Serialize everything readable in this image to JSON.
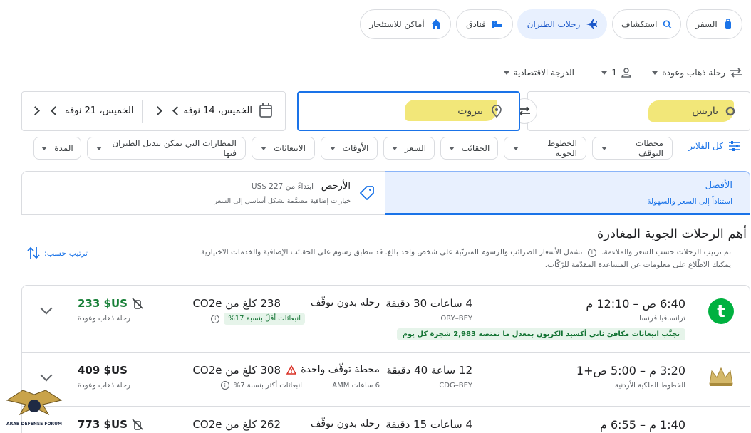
{
  "nav": {
    "travel": "السفر",
    "explore": "استكشاف",
    "flights": "رحلات الطيران",
    "hotels": "فنادق",
    "rentals": "أماكن للاستئجار"
  },
  "options": {
    "trip_type": "رحلة ذهاب وعودة",
    "passengers": "1",
    "cabin": "الدرجة الاقتصادية"
  },
  "search": {
    "origin": "باريس",
    "destination": "بيروت",
    "depart_date": "الخميس، 14 نوفه",
    "return_date": "الخميس، 21 نوفه"
  },
  "filters": {
    "all": "كل الفلاتر",
    "stops": "محطات التوقف",
    "airlines": "الخطوط الجوية",
    "bags": "الحقائب",
    "price": "السعر",
    "times": "الأوقات",
    "emissions": "الانبعاثات",
    "connecting": "المطارات التي يمكن تبديل الطيران فيها",
    "duration": "المدة"
  },
  "tabs": {
    "best_title": "الأفضل",
    "best_sub": "استناداً إلى السعر والسهولة",
    "cheapest_title": "الأرخص",
    "cheapest_from": "ابتداءً من 227 $US",
    "cheapest_sub": "خيارات إضافية مصمَّمة بشكل أساسي إلى السعر"
  },
  "results_header": {
    "title": "أهم الرحلات الجوية المغادرة",
    "note1": "تم ترتيب الرحلات حسب السعر والملاءمة.",
    "note1b": "تشمل الأسعار الضرائب والرسوم المترتّبة على شخص واحد بالغ. قد تنطبق رسوم على الحقائب الإضافية والخدمات الاختيارية.",
    "note2": "يمكنك الاطّلاع على معلومات عن المساعدة المقدّمة للرّكّاب.",
    "sort": "ترتيب حسب:"
  },
  "flights": [
    {
      "times": "6:40 ص – 12:10 م",
      "airline": "ترانسافيا فرنسا",
      "duration": "4 ساعات 30 دقيقة",
      "route": "ORY–BEY",
      "stops": "رحلة بدون توقّف",
      "stops_detail": "",
      "co2": "238 كلغ من CO2e",
      "co2_note": "انبعاثات أقلّ بنسبة 17%",
      "price": "233 $US",
      "trip": "رحلة ذهاب وعودة",
      "eco": "تجنَّب انبعاثات مكافئ ثاني أكسيد الكربون بمعدل ما تمتصه 2,983 شجرة كل يوم"
    },
    {
      "times": "3:20 م – 5:00 ص+1",
      "airline": "الخطوط الملكية الأردنية",
      "duration": "12 ساعة 40 دقيقة",
      "route": "CDG–BEY",
      "stops": "محطة توقّف واحدة",
      "stops_detail": "6 ساعات AMM",
      "co2": "308 كلغ من CO2e",
      "co2_note": "انبعاثات أكثر بنسبة 7%",
      "price": "409 $US",
      "trip": "رحلة ذهاب وعودة"
    },
    {
      "times": "1:40 م – 6:55 م",
      "airline": "",
      "duration": "4 ساعات 15 دقيقة",
      "route": "",
      "stops": "رحلة بدون توقّف",
      "stops_detail": "",
      "co2": "262 كلغ من CO2e",
      "co2_note": "",
      "price": "773 $US",
      "trip": ""
    }
  ],
  "watermark": "ARAB DEFENSE FORUM",
  "colors": {
    "accent": "#1a73e8",
    "green": "#188038",
    "highlight": "#f1e46a"
  }
}
